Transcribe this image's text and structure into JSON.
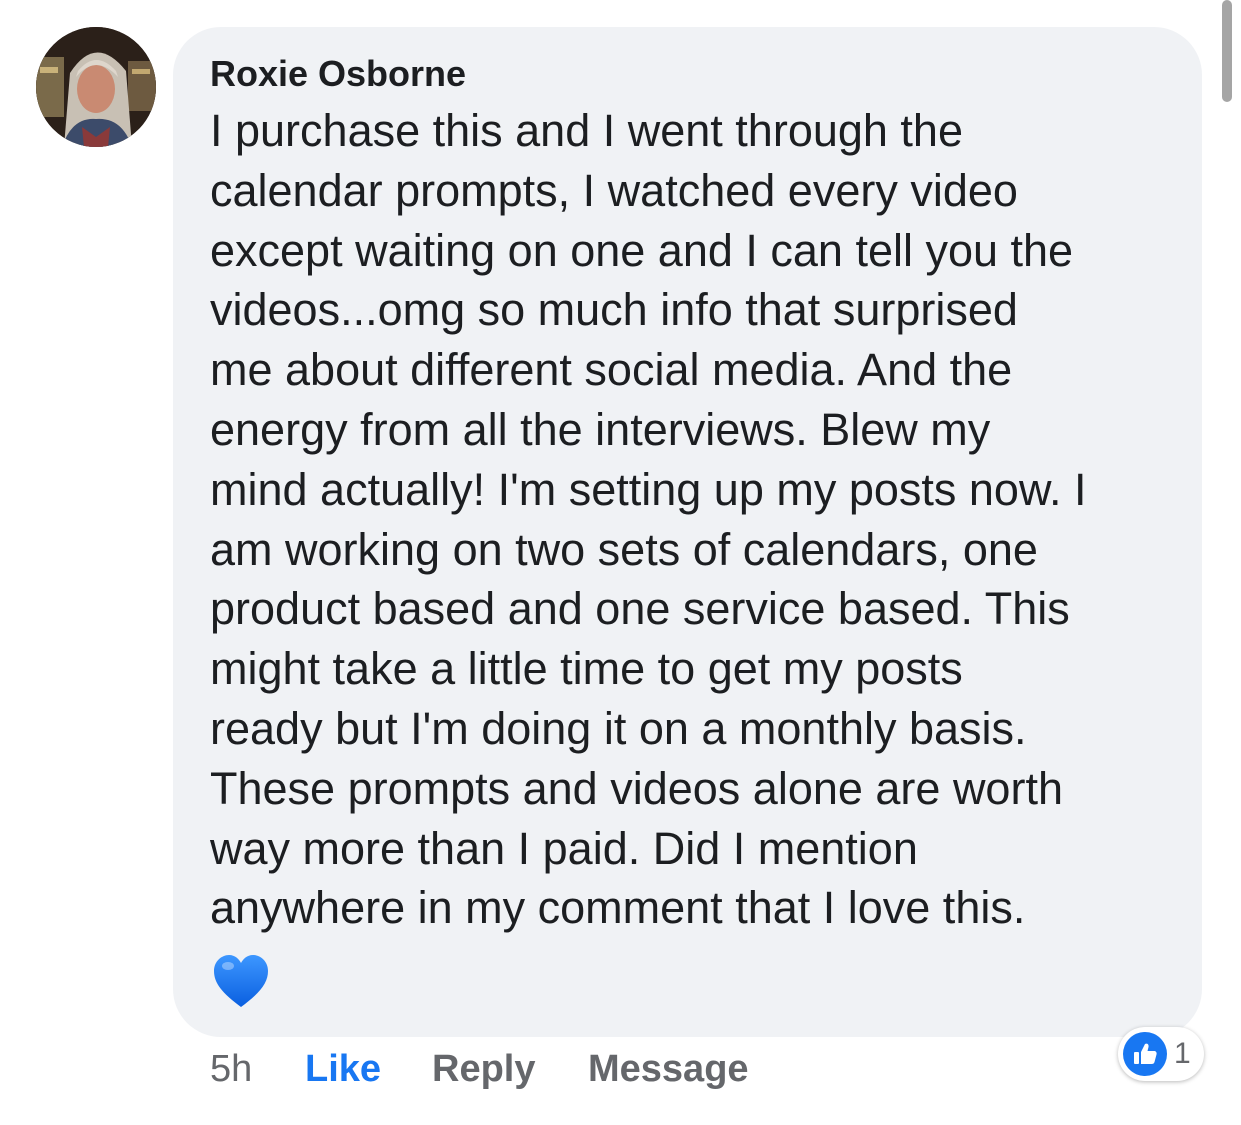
{
  "comment": {
    "author": "Roxie Osborne",
    "lines": [
      "I purchase this and I went through the",
      "calendar prompts, I watched every video",
      "except waiting on one and I can tell you the",
      "videos...omg so much info that surprised",
      "me about different social media. And the",
      "energy from all the interviews. Blew my",
      "mind actually! I'm setting up my posts now. I",
      "am working on two sets of calendars, one",
      "product based and one service based. This",
      "might take a little time to get my posts",
      "ready but I'm doing it on a monthly basis.",
      "These prompts and videos alone are worth",
      "way more than I paid. Did I mention",
      "anywhere in my comment that I love this."
    ],
    "emoji": "blue-heart-icon"
  },
  "actions": {
    "time": "5h",
    "like": "Like",
    "reply": "Reply",
    "message": "Message"
  },
  "reactions": {
    "icon": "thumbs-up-icon",
    "count": "1"
  },
  "colors": {
    "bubble": "#f0f2f5",
    "like_active": "#1877f2",
    "muted_text": "#65676b",
    "heart": "#1877f2"
  }
}
